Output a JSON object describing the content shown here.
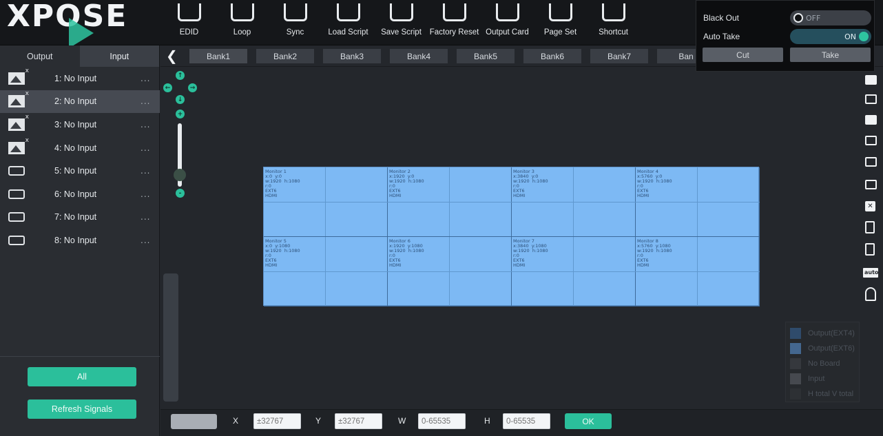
{
  "header": {
    "logo_text": "XPOSE",
    "toolbar": [
      {
        "label": "EDID",
        "icon": "edid-icon"
      },
      {
        "label": "Loop",
        "icon": "loop-icon"
      },
      {
        "label": "Sync",
        "icon": "sync-icon"
      },
      {
        "label": "Load Script",
        "icon": "load-script-icon"
      },
      {
        "label": "Save Script",
        "icon": "save-script-icon"
      },
      {
        "label": "Factory Reset",
        "icon": "factory-reset-icon"
      },
      {
        "label": "Output Card",
        "icon": "output-card-icon"
      },
      {
        "label": "Page Set",
        "icon": "page-set-icon"
      },
      {
        "label": "Shortcut",
        "icon": "shortcut-icon"
      }
    ]
  },
  "blackout_panel": {
    "black_out_label": "Black Out",
    "black_out_state": "OFF",
    "auto_take_label": "Auto Take",
    "auto_take_state": "ON",
    "cut_label": "Cut",
    "take_label": "Take"
  },
  "left_panel": {
    "tab_output": "Output",
    "tab_input": "Input",
    "inputs": [
      {
        "label": "1: No Input",
        "more": "...",
        "icon": "image-input-icon"
      },
      {
        "label": "2: No Input",
        "more": "...",
        "icon": "image-input-icon"
      },
      {
        "label": "3: No Input",
        "more": "...",
        "icon": "image-input-icon"
      },
      {
        "label": "4: No Input",
        "more": "...",
        "icon": "image-input-icon"
      },
      {
        "label": "5: No Input",
        "more": "...",
        "icon": "port-input-icon"
      },
      {
        "label": "6: No Input",
        "more": "...",
        "icon": "port-input-icon"
      },
      {
        "label": "7: No Input",
        "more": "...",
        "icon": "port-input-icon"
      },
      {
        "label": "8: No Input",
        "more": "...",
        "icon": "port-input-icon"
      }
    ],
    "selected_input": 2,
    "all_button": "All",
    "refresh_button": "Refresh Signals"
  },
  "banks": {
    "back_icon": "chevron-left-icon",
    "tabs": [
      "Bank1",
      "Bank2",
      "Bank3",
      "Bank4",
      "Bank5",
      "Bank6",
      "Bank7",
      "Ban"
    ],
    "active": "Bank1"
  },
  "monitors": [
    {
      "name": "Monitor 1",
      "pos": "x:0  y:0",
      "size": "w:1920  h:1080",
      "r": "r:0",
      "card": "EXT6",
      "port": "HDMI"
    },
    {
      "name": "Monitor 2",
      "pos": "x:1920  y:0",
      "size": "w:1920  h:1080",
      "r": "r:0",
      "card": "EXT6",
      "port": "HDMI"
    },
    {
      "name": "Monitor 3",
      "pos": "x:3840  y:0",
      "size": "w:1920  h:1080",
      "r": "r:0",
      "card": "EXT6",
      "port": "HDMI"
    },
    {
      "name": "Monitor 4",
      "pos": "x:5760  y:0",
      "size": "w:1920  h:1080",
      "r": "r:0",
      "card": "EXT6",
      "port": "HDMI"
    },
    {
      "name": "Monitor 5",
      "pos": "x:0  y:1080",
      "size": "w:1920  h:1080",
      "r": "r:0",
      "card": "EXT6",
      "port": "HDMI"
    },
    {
      "name": "Monitor 6",
      "pos": "x:1920  y:1080",
      "size": "w:1920  h:1080",
      "r": "r:0",
      "card": "EXT6",
      "port": "HDMI"
    },
    {
      "name": "Monitor 7",
      "pos": "x:3840  y:1080",
      "size": "w:1920  h:1080",
      "r": "r:0",
      "card": "EXT6",
      "port": "HDMI"
    },
    {
      "name": "Monitor 8",
      "pos": "x:5760  y:1080",
      "size": "w:1920  h:1080",
      "r": "r:0",
      "card": "EXT6",
      "port": "HDMI"
    }
  ],
  "legend": [
    {
      "label": "Output(EXT4)",
      "color": "#2f4b6b"
    },
    {
      "label": "Output(EXT6)",
      "color": "#44678f"
    },
    {
      "label": "No Board",
      "color": "#35383d"
    },
    {
      "label": "Input",
      "color": "#46494f"
    },
    {
      "label": "H total V total",
      "color": "#2d3034"
    }
  ],
  "colors": {
    "accent": "#2bbf9b",
    "monitor_fill": "#7db9f4"
  },
  "bottom_bar": {
    "x_label": "X",
    "x_placeholder": "±32767",
    "y_label": "Y",
    "y_placeholder": "±32767",
    "w_label": "W",
    "w_placeholder": "0-65535",
    "h_label": "H",
    "h_placeholder": "0-65535",
    "ok_label": "OK"
  }
}
